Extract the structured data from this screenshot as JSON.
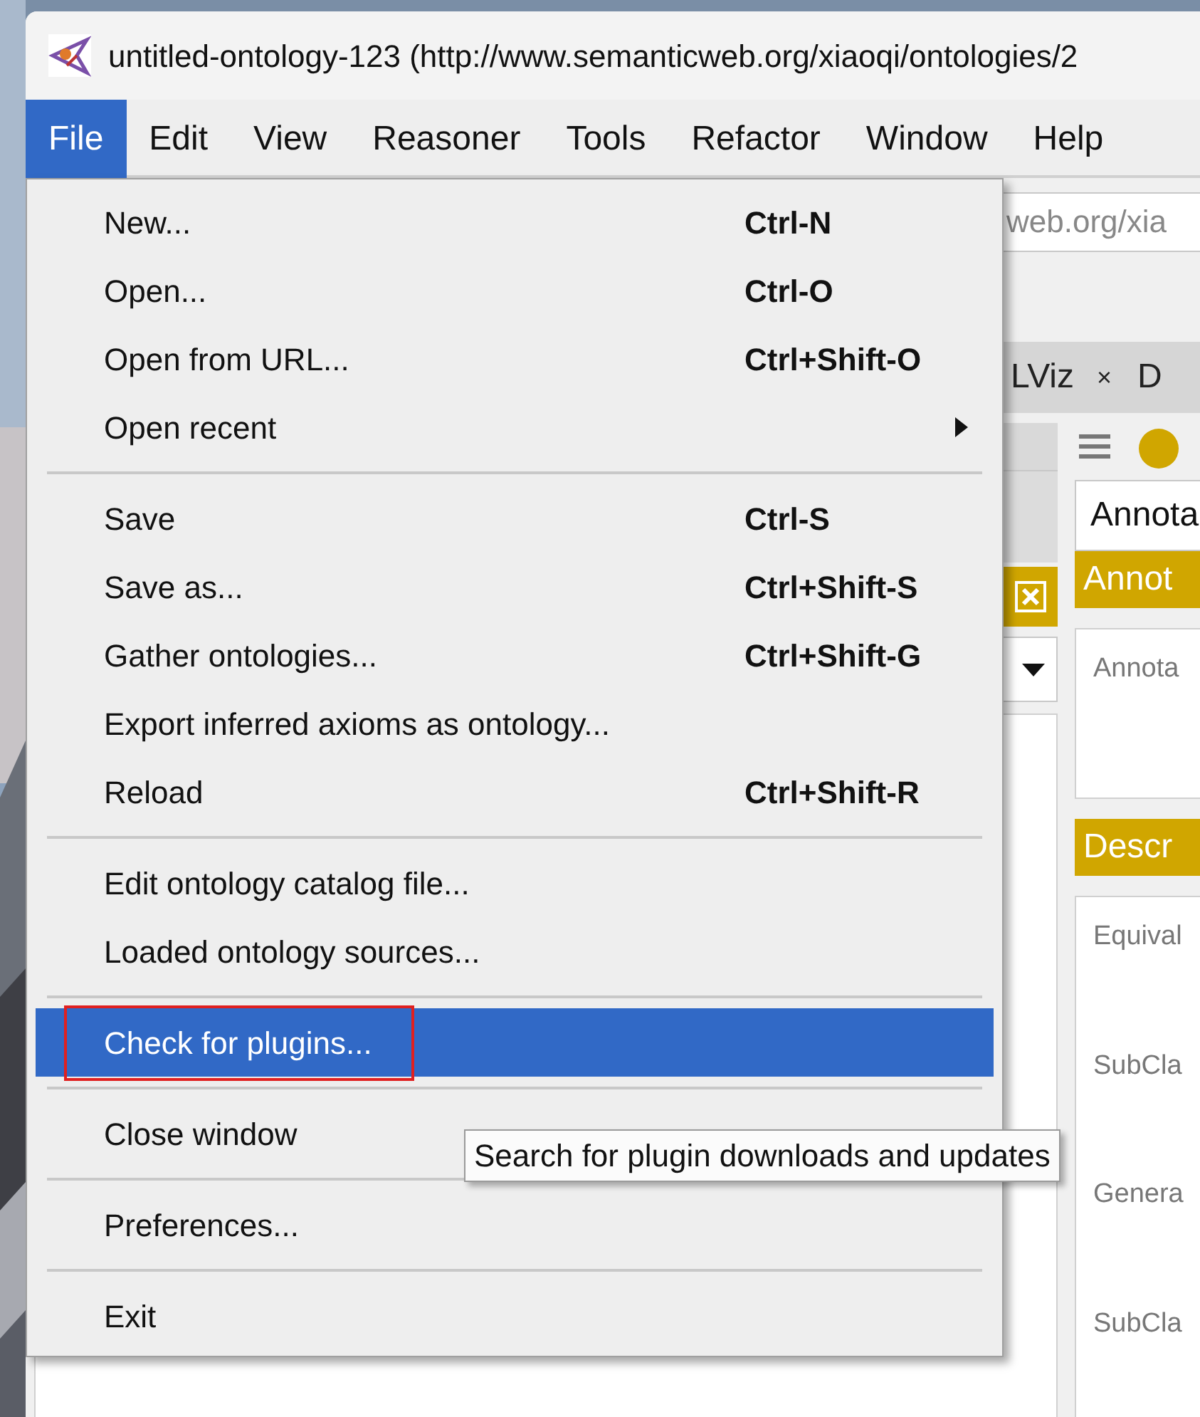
{
  "window": {
    "title": "untitled-ontology-123 (http://www.semanticweb.org/xiaoqi/ontologies/2"
  },
  "menu_bar": [
    {
      "label": "File",
      "selected": true
    },
    {
      "label": "Edit",
      "selected": false
    },
    {
      "label": "View",
      "selected": false
    },
    {
      "label": "Reasoner",
      "selected": false
    },
    {
      "label": "Tools",
      "selected": false
    },
    {
      "label": "Refactor",
      "selected": false
    },
    {
      "label": "Window",
      "selected": false
    },
    {
      "label": "Help",
      "selected": false
    }
  ],
  "file_menu": {
    "sections": [
      {
        "items": [
          {
            "label": "New...",
            "shortcut": "Ctrl-N",
            "selected": false,
            "outlined": false,
            "submenu": false
          },
          {
            "label": "Open...",
            "shortcut": "Ctrl-O",
            "selected": false,
            "outlined": false,
            "submenu": false
          },
          {
            "label": "Open from URL...",
            "shortcut": "Ctrl+Shift-O",
            "selected": false,
            "outlined": false,
            "submenu": false
          },
          {
            "label": "Open recent",
            "selected": false,
            "outlined": false,
            "submenu": true
          }
        ]
      },
      {
        "items": [
          {
            "label": "Save",
            "shortcut": "Ctrl-S",
            "selected": false,
            "outlined": false,
            "submenu": false
          },
          {
            "label": "Save as...",
            "shortcut": "Ctrl+Shift-S",
            "selected": false,
            "outlined": false,
            "submenu": false
          },
          {
            "label": "Gather ontologies...",
            "shortcut": "Ctrl+Shift-G",
            "selected": false,
            "outlined": false,
            "submenu": false
          },
          {
            "label": "Export inferred axioms as ontology...",
            "selected": false,
            "outlined": false,
            "submenu": false
          },
          {
            "label": "Reload",
            "shortcut": "Ctrl+Shift-R",
            "selected": false,
            "outlined": false,
            "submenu": false
          }
        ]
      },
      {
        "items": [
          {
            "label": "Edit ontology catalog file...",
            "selected": false,
            "outlined": false,
            "submenu": false
          },
          {
            "label": "Loaded ontology sources...",
            "selected": false,
            "outlined": false,
            "submenu": false
          }
        ]
      },
      {
        "items": [
          {
            "label": "Check for plugins...",
            "selected": true,
            "outlined": true,
            "submenu": false
          }
        ]
      },
      {
        "items": [
          {
            "label": "Close window",
            "selected": false,
            "outlined": false,
            "submenu": false
          }
        ]
      },
      {
        "items": [
          {
            "label": "Preferences...",
            "selected": false,
            "outlined": false,
            "submenu": false
          }
        ]
      },
      {
        "items": [
          {
            "label": "Exit",
            "selected": false,
            "outlined": false,
            "submenu": false
          }
        ]
      }
    ]
  },
  "tooltip": {
    "text": "Search for plugin downloads and updates"
  },
  "background": {
    "url_field": "web.org/xia",
    "tabs": [
      {
        "label": "LViz",
        "close": "×"
      },
      {
        "label": "D"
      }
    ],
    "annotation_field": "Annota",
    "sections": [
      {
        "header": "Annot",
        "labels": [
          "Annota"
        ]
      },
      {
        "header": "Descr",
        "labels": [
          "Equival",
          "SubCla",
          "Genera",
          "SubCla"
        ]
      }
    ]
  }
}
